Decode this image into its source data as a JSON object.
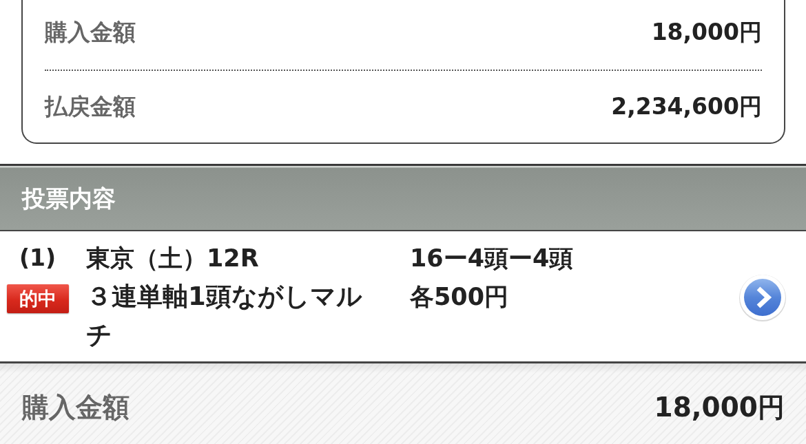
{
  "summary": {
    "rows": [
      {
        "label": "購入金額",
        "value": "18,000円"
      },
      {
        "label": "払戻金額",
        "value": "2,234,600円"
      }
    ]
  },
  "bets": {
    "title": "投票内容",
    "items": [
      {
        "number": "(1)",
        "result": "的中",
        "race": "東京（土）12R",
        "bet_type": "３連単軸1頭ながしマルチ",
        "combination": "16ー4頭ー4頭",
        "stake": "各500円"
      }
    ]
  },
  "total": {
    "label": "購入金額",
    "value": "18,000円"
  }
}
